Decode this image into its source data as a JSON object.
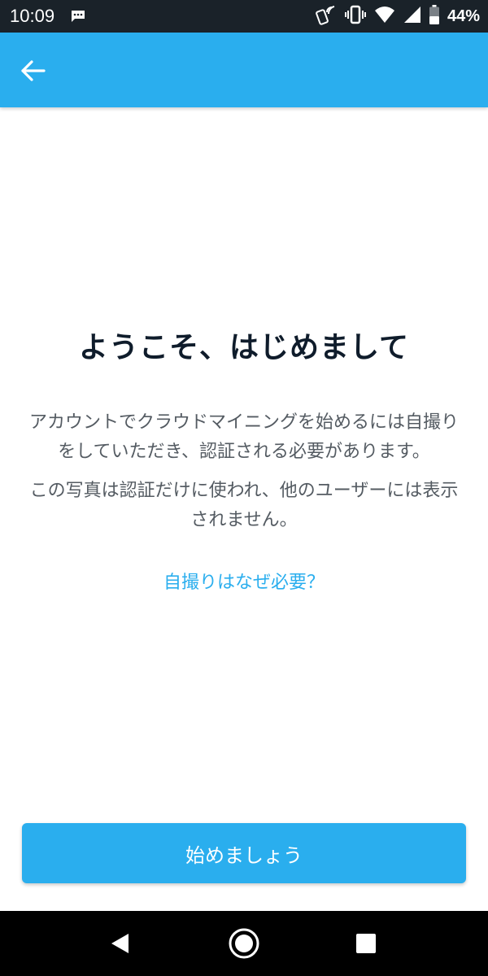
{
  "status_bar": {
    "time": "10:09",
    "battery": "44%",
    "icons": [
      "message-icon",
      "nfc-icon",
      "vibrate-icon",
      "wifi-icon",
      "signal-icon",
      "battery-icon"
    ]
  },
  "app_bar": {
    "back_icon": "arrow-back-icon",
    "color": "#2aaeee"
  },
  "content": {
    "title": "ようこそ、はじめまして",
    "paragraph1": "アカウントでクラウドマイニングを始めるには自撮りをしていただき、認証される必要があります。",
    "paragraph2": "この写真は認証だけに使われ、他のユーザーには表示されません。",
    "why_link": "自撮りはなぜ必要？"
  },
  "start_button": {
    "label": "始めましょう",
    "color": "#2aaeee"
  },
  "nav_bar": {
    "icons": [
      "nav-back-icon",
      "nav-home-icon",
      "nav-recents-icon"
    ]
  }
}
